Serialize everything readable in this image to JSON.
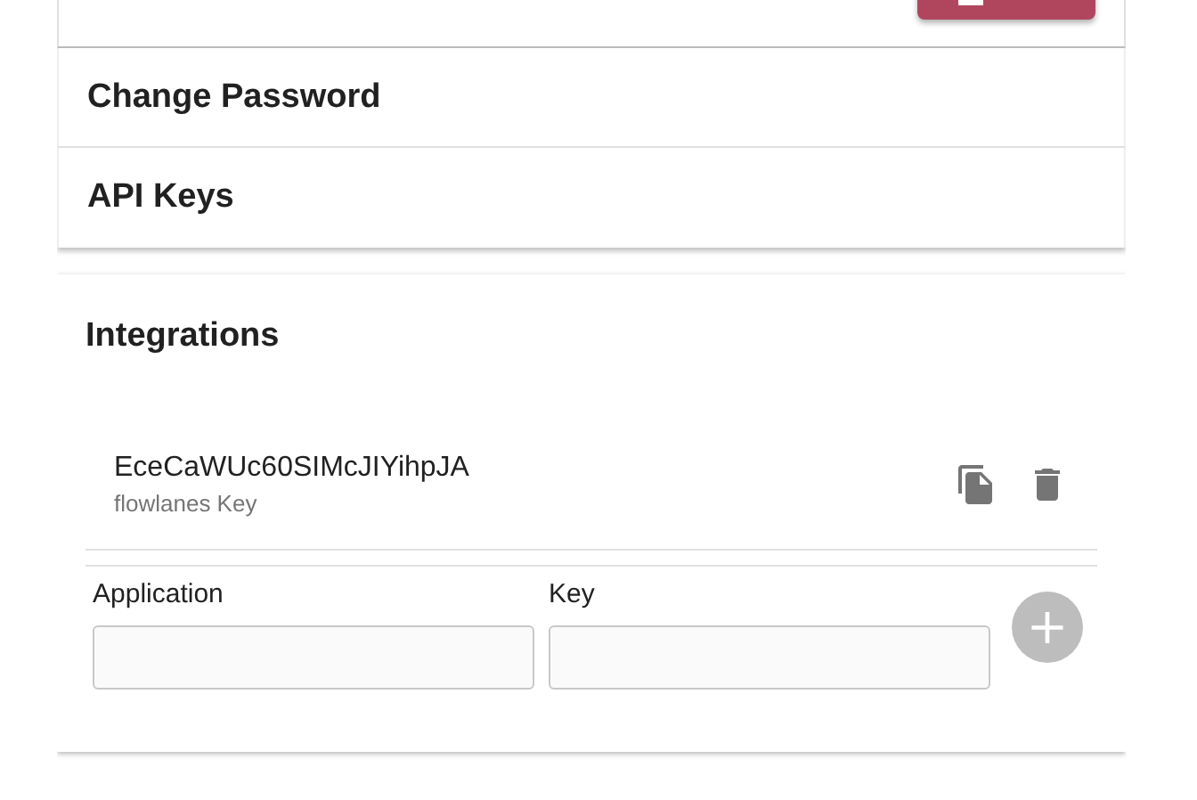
{
  "top_button": {
    "kind": "primary"
  },
  "sections": [
    {
      "title": "Change Password"
    },
    {
      "title": "API Keys"
    }
  ],
  "integrations": {
    "title": "Integrations",
    "keys": [
      {
        "key": "EceCaWUc60SIMcJIYihpJA",
        "label": "flowlanes Key"
      }
    ],
    "form": {
      "application_label": "Application",
      "key_label": "Key",
      "add_disabled": true,
      "add_icon": "+"
    }
  }
}
